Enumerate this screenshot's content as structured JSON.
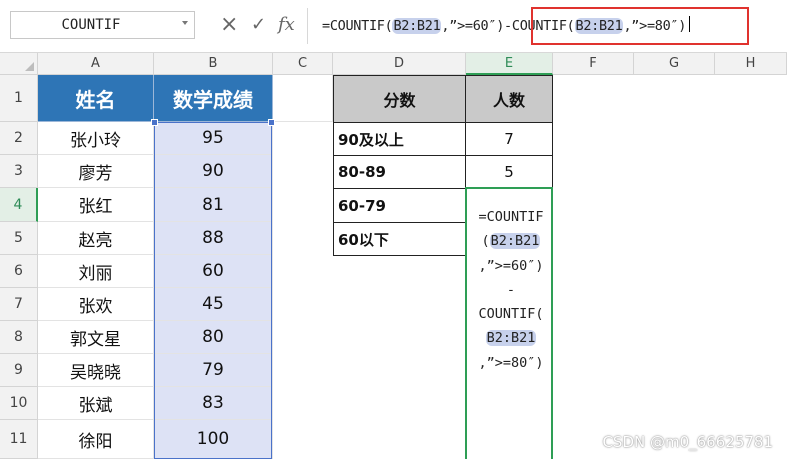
{
  "formula_bar": {
    "name_box": "COUNTIF",
    "cancel_icon": "×",
    "confirm_icon": "✓",
    "fx_icon": "fx",
    "formula_parts": [
      "=COUNTIF(",
      "B2:B21",
      ",”>=60″)-",
      "COUNTIF(",
      "B2:B21",
      ",”>=80″)"
    ]
  },
  "columns": [
    "A",
    "B",
    "C",
    "D",
    "E",
    "F",
    "G",
    "H"
  ],
  "rows": [
    "1",
    "2",
    "3",
    "4",
    "5",
    "6",
    "7",
    "8",
    "9",
    "10",
    "11"
  ],
  "sheet": {
    "col_a_header": "姓名",
    "col_b_header": "数学成绩",
    "names": [
      "张小玲",
      "廖芳",
      "张红",
      "赵亮",
      "刘丽",
      "张欢",
      "郭文星",
      "吴晓晓",
      "张斌",
      "徐阳"
    ],
    "scores": [
      "95",
      "90",
      "81",
      "88",
      "60",
      "45",
      "80",
      "79",
      "83",
      "100"
    ],
    "summary_header_d": "分数",
    "summary_header_e": "人数",
    "summary_ranges": [
      "90及以上",
      "80-89",
      "60-79",
      "60以下"
    ],
    "summary_counts": [
      "7",
      "5"
    ]
  },
  "edit_cell_lines": [
    "=COUNTIF",
    "(",
    "B2:B21",
    ",”>=60″)",
    "-",
    "COUNTIF(",
    "B2:B21",
    ",”>=80″)"
  ],
  "watermark": "CSDN @m0_66625781",
  "colors": {
    "header_blue": "#2e75b6",
    "selection_fill": "#dde2f5",
    "summary_header": "#c9c9c9",
    "active_green": "#2e9e55",
    "highlight_box": "#e0322e"
  }
}
